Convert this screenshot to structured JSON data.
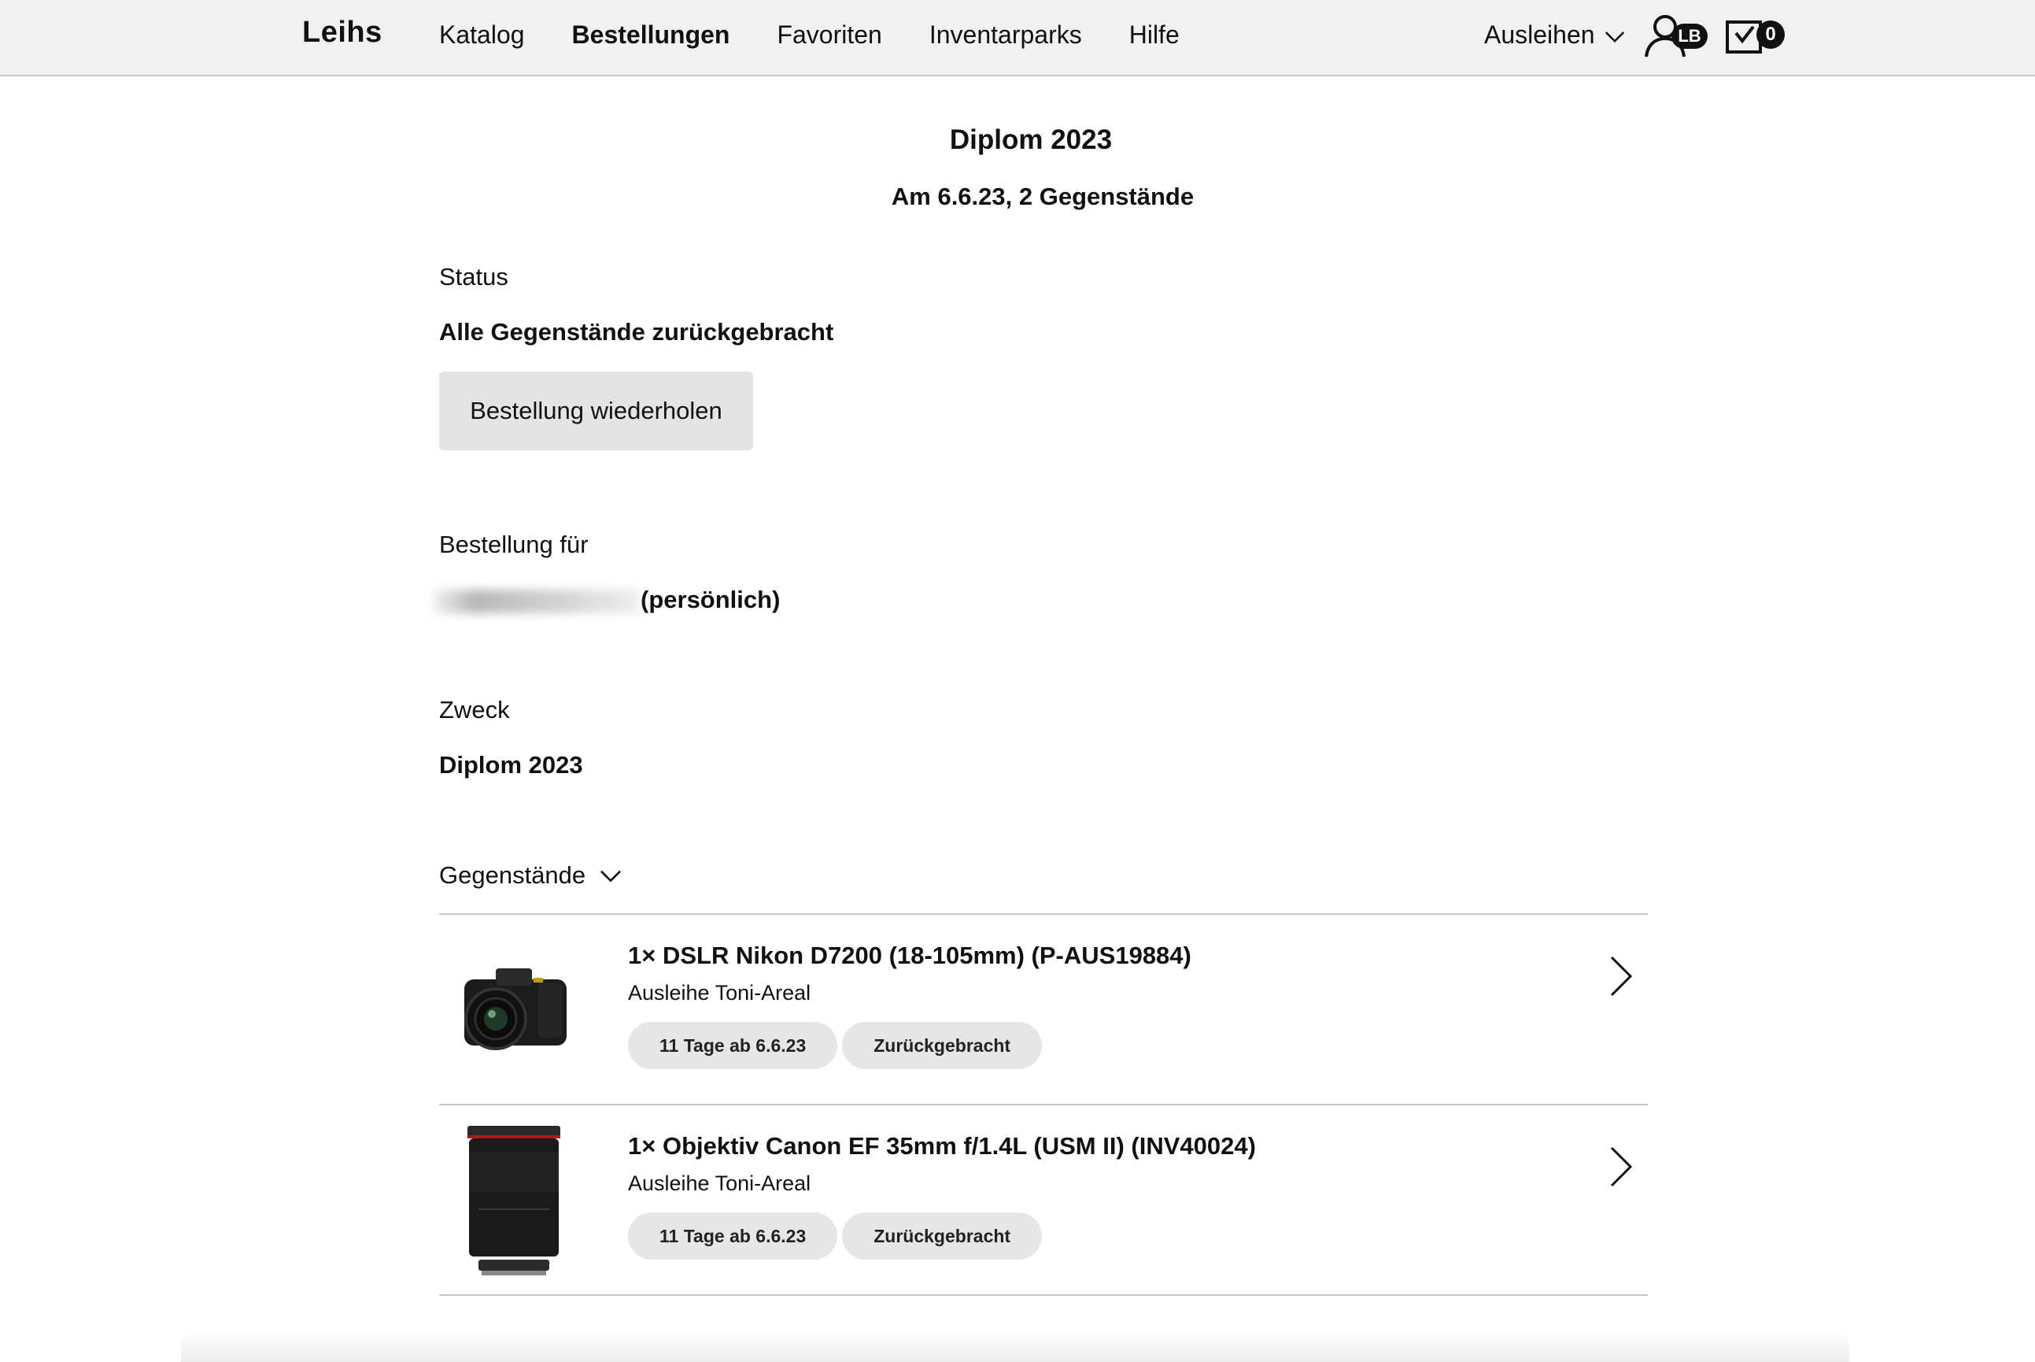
{
  "nav": {
    "brand": "Leihs",
    "links": [
      "Katalog",
      "Bestellungen",
      "Favoriten",
      "Inventarparks",
      "Hilfe"
    ],
    "active_link": "Bestellungen",
    "borrow_menu_label": "Ausleihen",
    "user_initials": "LB",
    "cart_count": "0"
  },
  "order": {
    "title": "Diplom 2023",
    "subtitle": "Am 6.6.23, 2 Gegenstände",
    "status_label": "Status",
    "status_value": "Alle Gegenstände zurückgebracht",
    "repeat_button": "Bestellung wiederholen",
    "for_label": "Bestellung für",
    "for_suffix": "(persönlich)",
    "purpose_label": "Zweck",
    "purpose_value": "Diplom 2023",
    "items_toggle_label": "Gegenstände"
  },
  "items": [
    {
      "name": "1× DSLR Nikon D7200 (18-105mm) (P-AUS19884)",
      "location": "Ausleihe Toni-Areal",
      "duration": "11 Tage ab 6.6.23",
      "status": "Zurückgebracht",
      "thumbnail": "camera-image"
    },
    {
      "name": "1× Objektiv Canon EF 35mm f/1.4L (USM II) (INV40024)",
      "location": "Ausleihe Toni-Areal",
      "duration": "11 Tage ab 6.6.23",
      "status": "Zurückgebracht",
      "thumbnail": "lens-image"
    }
  ],
  "colors": {
    "topbar_bg": "#f1f1f1",
    "button_bg": "#e4e4e4",
    "pill_bg": "#e6e6e6",
    "badge_bg": "#111111"
  }
}
